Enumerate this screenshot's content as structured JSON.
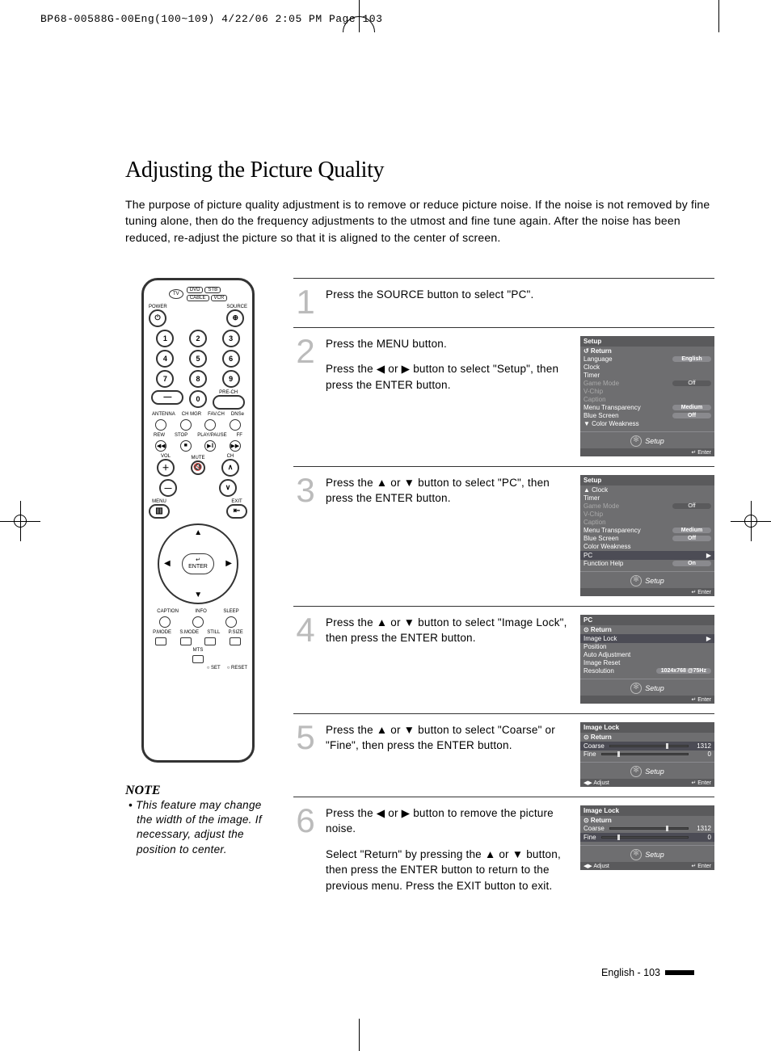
{
  "header_line": "BP68-00588G-00Eng(100~109)  4/22/06  2:05 PM  Page 103",
  "title": "Adjusting the Picture Quality",
  "intro": "The purpose of picture quality adjustment is to remove or reduce picture noise. If the noise is not removed by fine tuning alone, then do the frequency adjustments to the utmost and fine tune again. After the noise has been reduced, re-adjust the picture so that it is aligned to the center of screen.",
  "remote": {
    "src": {
      "tv": "TV",
      "dvd": "DVD",
      "stb": "STB",
      "cable": "CABLE",
      "vcr": "VCR"
    },
    "power": "POWER",
    "source": "SOURCE",
    "prech": "PRE-CH",
    "ant": "ANTENNA",
    "chmgr": "CH MGR",
    "favch": "FAV.CH",
    "dnse": "DNSe",
    "rew": "REW",
    "stop": "STOP",
    "playpause": "PLAY/PAUSE",
    "ff": "FF",
    "vol": "VOL",
    "ch": "CH",
    "mute": "MUTE",
    "menu": "MENU",
    "exit": "EXIT",
    "enter": "ENTER",
    "caption": "CAPTION",
    "info": "INFO",
    "sleep": "SLEEP",
    "pmode": "P.MODE",
    "smode": "S.MODE",
    "still": "STILL",
    "psize": "P.SIZE",
    "mts": "MTS",
    "set": "○ SET",
    "reset": "○ RESET"
  },
  "note_head": "NOTE",
  "note_body": "• This feature may change the width of the image. If necessary, adjust the position to center.",
  "steps": [
    {
      "n": "1",
      "text": [
        "Press the SOURCE button to select \"PC\"."
      ],
      "osd": null
    },
    {
      "n": "2",
      "text": [
        "Press the MENU button.",
        "Press the ◀ or ▶ button to select \"Setup\", then press the ENTER button."
      ],
      "osd": {
        "title": "Setup",
        "rows": [
          {
            "l": "↺ Return",
            "b": true
          },
          {
            "l": "Language",
            "v": "English",
            "vhi": true
          },
          {
            "l": "Clock"
          },
          {
            "l": "Timer"
          },
          {
            "l": "Game Mode",
            "v": "Off",
            "dim": true
          },
          {
            "l": "V-Chip",
            "dim": true
          },
          {
            "l": "Caption",
            "dim": true
          },
          {
            "l": "Menu Transparency",
            "v": "Medium",
            "vhi": true
          },
          {
            "l": "Blue Screen",
            "v": "Off",
            "vhi": true
          },
          {
            "l": "▼ Color Weakness"
          }
        ],
        "footer": "Setup",
        "hint_r": "↵ Enter"
      }
    },
    {
      "n": "3",
      "text": [
        "Press the ▲ or ▼ button to select \"PC\", then press the ENTER button."
      ],
      "osd": {
        "title": "Setup",
        "rows": [
          {
            "l": "▲ Clock"
          },
          {
            "l": "Timer"
          },
          {
            "l": "Game Mode",
            "v": "Off",
            "dim": true
          },
          {
            "l": "V-Chip",
            "dim": true
          },
          {
            "l": "Caption",
            "dim": true
          },
          {
            "l": "Menu Transparency",
            "v": "Medium",
            "vhi": true
          },
          {
            "l": "Blue Screen",
            "v": "Off",
            "vhi": true
          },
          {
            "l": "Color Weakness"
          },
          {
            "l": "PC",
            "hi": true,
            "arrow": true
          },
          {
            "l": "Function Help",
            "v": "On",
            "vhi": true
          }
        ],
        "footer": "Setup",
        "hint_r": "↵ Enter"
      }
    },
    {
      "n": "4",
      "text": [
        "Press the ▲ or ▼ button to select \"Image Lock\", then press the ENTER button."
      ],
      "osd": {
        "title": "PC",
        "rows": [
          {
            "l": "⊙ Return",
            "b": true
          },
          {
            "l": "Image Lock",
            "hi": true,
            "arrow": true
          },
          {
            "l": "Position"
          },
          {
            "l": "Auto Adjustment"
          },
          {
            "l": "Image Reset"
          },
          {
            "l": "Resolution",
            "v": "1024x768 @75Hz",
            "vhi": true
          }
        ],
        "footer": "Setup",
        "hint_r": "↵ Enter"
      }
    },
    {
      "n": "5",
      "text": [
        "Press the ▲ or ▼ button to select \"Coarse\" or \"Fine\", then press the ENTER button."
      ],
      "osd": {
        "title": "Image Lock",
        "rows": [
          {
            "l": "⊙ Return",
            "b": true
          },
          {
            "l": "Coarse",
            "slider": {
              "pos": 72,
              "val": "1312"
            },
            "hi": true
          },
          {
            "l": "Fine",
            "slider": {
              "pos": 18,
              "val": "0"
            }
          }
        ],
        "footer": "Setup",
        "hint_l": "◀▶ Adjust",
        "hint_r": "↵ Enter"
      }
    },
    {
      "n": "6",
      "text": [
        "Press the ◀ or ▶ button to remove the picture noise.",
        "Select \"Return\" by pressing the ▲ or ▼ button, then press the ENTER button to return to the previous menu. Press the EXIT button to exit."
      ],
      "osd": {
        "title": "Image Lock",
        "rows": [
          {
            "l": "⊙ Return",
            "b": true
          },
          {
            "l": "Coarse",
            "slider": {
              "pos": 72,
              "val": "1312"
            }
          },
          {
            "l": "Fine",
            "slider": {
              "pos": 18,
              "val": "0"
            },
            "hi": true
          }
        ],
        "footer": "Setup",
        "hint_l": "◀▶ Adjust",
        "hint_r": "↵ Enter"
      }
    }
  ],
  "page_num": "English - 103"
}
